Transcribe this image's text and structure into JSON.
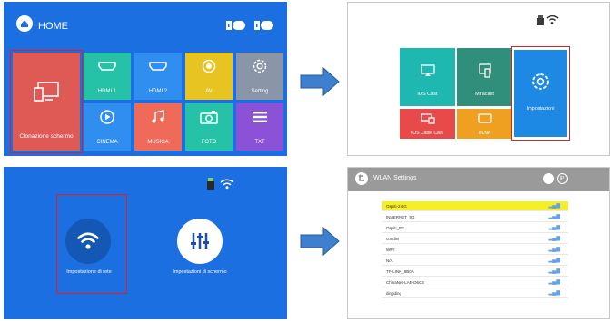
{
  "panel1": {
    "title": "HOME",
    "tiles": {
      "mirror": "Clonazione schermo",
      "hdmi1": "HDMI 1",
      "hdmi2": "HDMI 2",
      "av": "AV",
      "setting": "Setting",
      "cinema": "CINEMA",
      "musica": "MUSICA",
      "foto": "FOTO",
      "txt": "TXT"
    },
    "colors": {
      "bg": "#1b6fe0",
      "mirror": "#e05a55",
      "hdmi1": "#25c2a8",
      "hdmi2": "#2f8ef0",
      "av": "#e7c421",
      "setting": "#8a96a8",
      "cinema": "#2f8ef0",
      "musica": "#f06a5a",
      "foto": "#25c2a8",
      "txt": "#8b52d8"
    }
  },
  "panel2": {
    "tiles": {
      "ios_cast": "iOS Cast",
      "miracast": "Miracast",
      "impostazioni": "Impostazioni",
      "ios_cable": "iOS Cable Cast",
      "dlna": "DLNA"
    },
    "colors": {
      "ios_cast": "#1fb8b0",
      "miracast": "#2f8f7a",
      "impostazioni": "#1e88e5",
      "ios_cable": "#e84a4a",
      "dlna": "#f0a020"
    }
  },
  "panel3": {
    "net": "Impostazione di rete",
    "screen": "Impostazioni di schermo"
  },
  "panel4": {
    "title": "WLAN Settings",
    "networks": [
      "Ospiti-2.4G",
      "INNERNET_5G",
      "Ospiti_5G",
      "condivi",
      "WIFI",
      "N/A",
      "TP-LINK_8B0A",
      "ChinaNet-LAB-D6C3",
      "dingding"
    ]
  },
  "icons": [
    "home-icon",
    "usb-icon",
    "hdmi-icon",
    "av-icon",
    "gear-icon",
    "play-icon",
    "music-icon",
    "camera-icon",
    "menu-icon",
    "screen-icon",
    "wifi-icon",
    "sliders-icon",
    "back-icon",
    "arrow-icon"
  ]
}
